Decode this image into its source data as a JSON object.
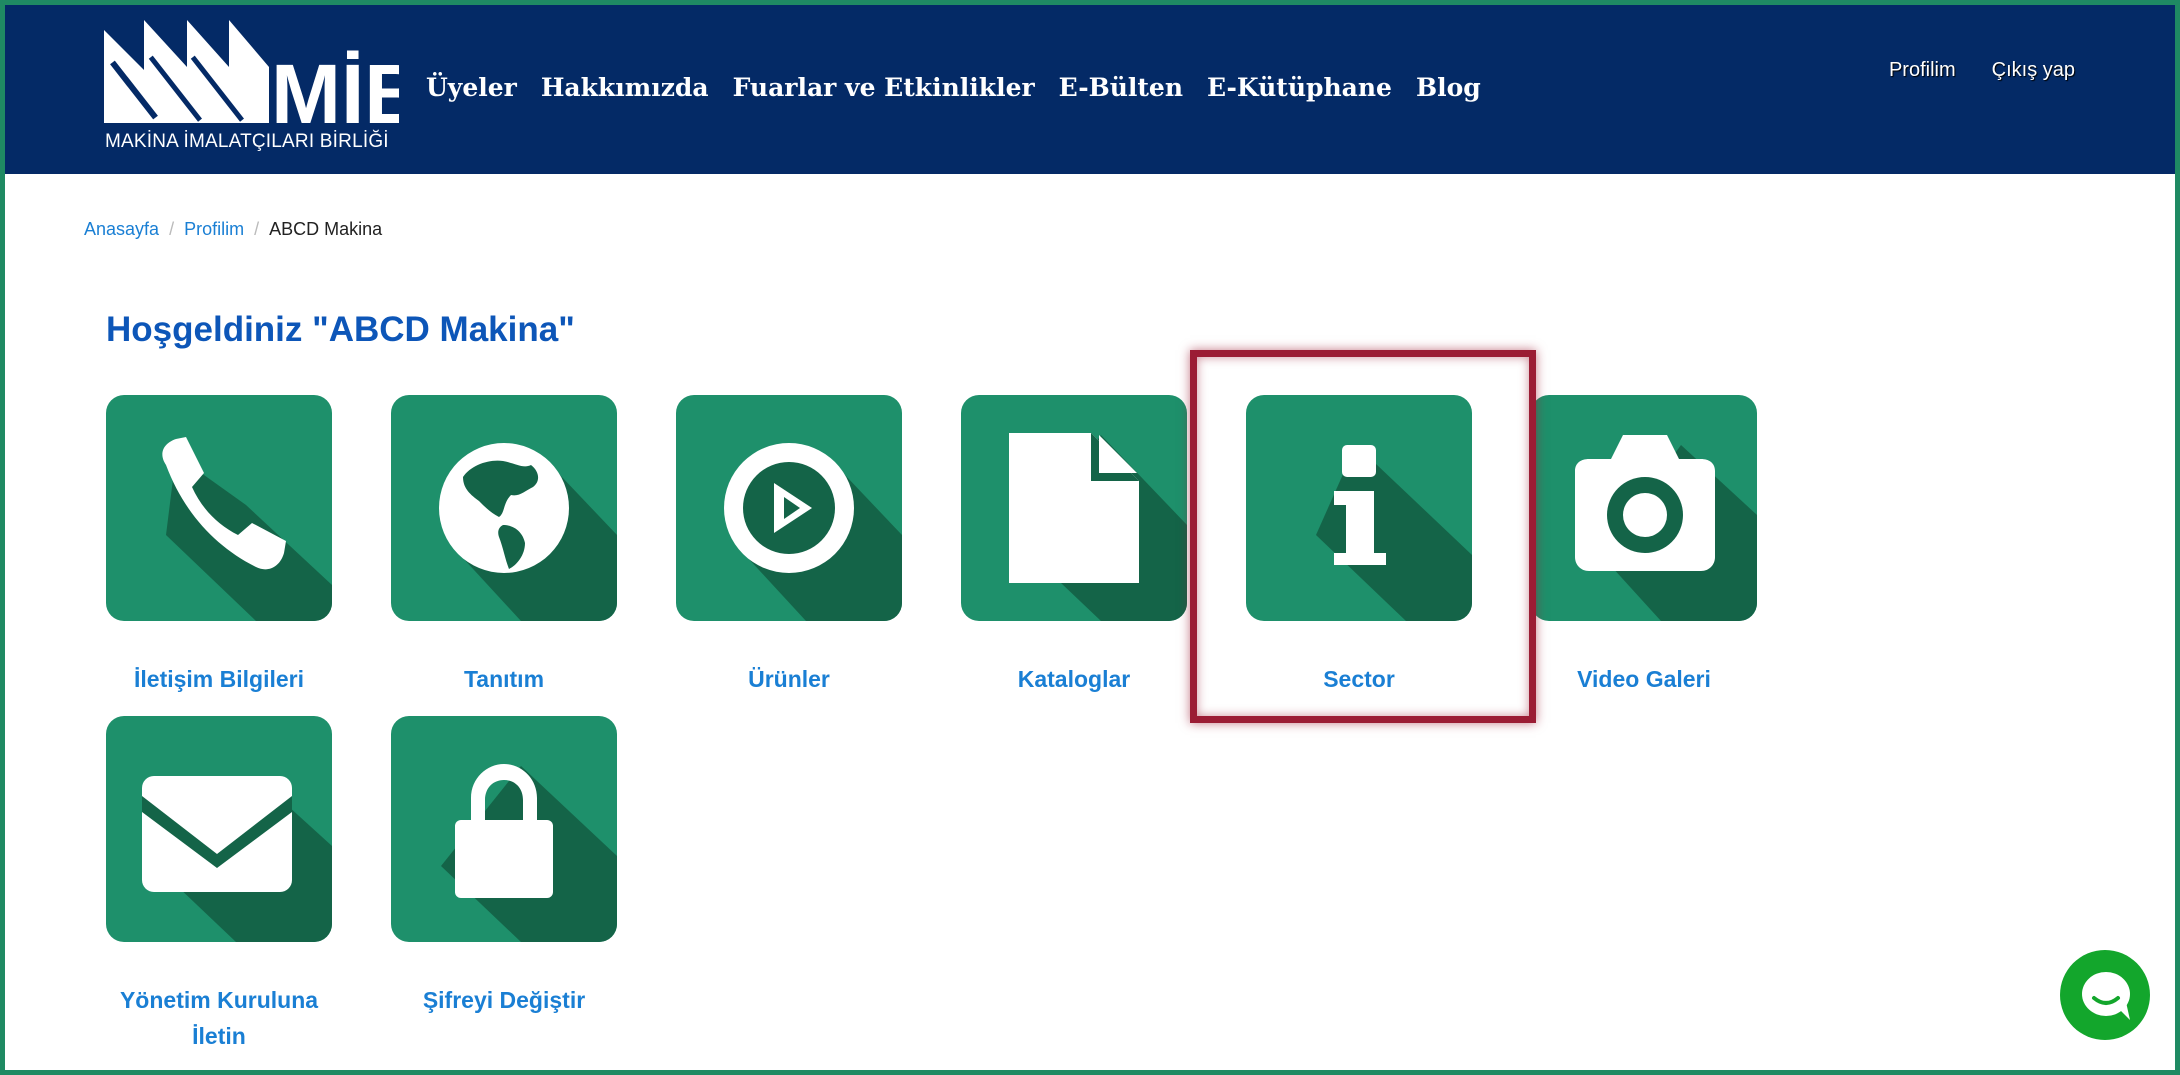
{
  "header": {
    "logo_text": "MİB",
    "logo_subtitle": "MAKİNA İMALATÇILARI BİRLİĞİ",
    "nav": [
      "Üyeler",
      "Hakkımızda",
      "Fuarlar ve Etkinlikler",
      "E-Bülten",
      "E-Kütüphane",
      "Blog"
    ],
    "top_links": {
      "profile": "Profilim",
      "logout": "Çıkış yap"
    }
  },
  "breadcrumb": {
    "home": "Anasayfa",
    "profile": "Profilim",
    "current": "ABCD Makina"
  },
  "welcome": "Hoşgeldiniz \"ABCD Makina\"",
  "tiles": [
    {
      "label": "İletişim Bilgileri",
      "icon": "phone-icon"
    },
    {
      "label": "Tanıtım",
      "icon": "globe-icon"
    },
    {
      "label": "Ürünler",
      "icon": "play-circle-icon"
    },
    {
      "label": "Kataloglar",
      "icon": "document-icon"
    },
    {
      "label": "Sector",
      "icon": "info-icon"
    },
    {
      "label": "Video Galeri",
      "icon": "camera-icon"
    },
    {
      "label": "Yönetim Kuruluna İletin",
      "icon": "envelope-icon"
    },
    {
      "label": "Şifreyi Değiştir",
      "icon": "lock-icon"
    }
  ],
  "colors": {
    "header_bg": "#042a66",
    "tile_bg": "#1e906b",
    "tile_shadow": "#146448",
    "link": "#1a7fd4",
    "highlight": "#9b1c34",
    "chat": "#13a62c"
  }
}
